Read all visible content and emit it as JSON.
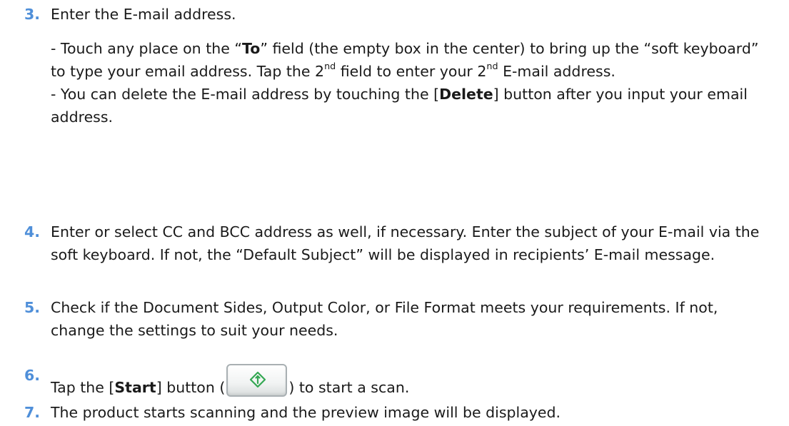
{
  "steps": [
    {
      "number": "3.",
      "text": "Enter the E-mail address.",
      "sub1": {
        "a": "- Touch any place on the “",
        "b": "To",
        "c": "” field (the empty box in the center) to bring up the “soft keyboard” to type your email address.   Tap the 2",
        "d": "nd",
        "e": " field to enter your 2",
        "f": "nd",
        "g": " E-mail address."
      },
      "sub2": {
        "a": "- You can delete the E-mail address by touching the [",
        "b": "Delete",
        "c": "] button after you input your email address."
      }
    },
    {
      "number": "4.",
      "text": "Enter or select CC and BCC address as well, if necessary.   Enter the subject of your E-mail via the soft keyboard.   If not, the “Default Subject” will be displayed in recipients’ E-mail message."
    },
    {
      "number": "5.",
      "text": "Check if the Document Sides, Output Color, or File Format meets your requirements.   If not, change the settings to suit your needs."
    },
    {
      "number": "6.",
      "a": "Tap the [",
      "b": "Start",
      "c": "] button (",
      "d": ") to start a scan.",
      "button_icon": "start-diamond-icon"
    },
    {
      "number": "7.",
      "text": "The product starts scanning and the preview image will be displayed."
    }
  ],
  "colors": {
    "step_number": "#4f8fd9",
    "start_icon": "#34a853"
  }
}
